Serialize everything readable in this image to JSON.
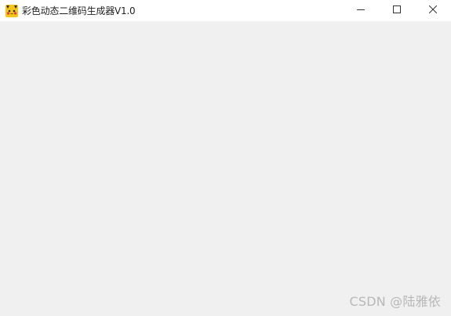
{
  "window": {
    "title": "彩色动态二维码生成器V1.0",
    "app_icon": "pikachu-icon",
    "controls": {
      "minimize": "minimize-icon",
      "maximize": "maximize-icon",
      "close": "close-icon"
    }
  },
  "watermark": {
    "text": "CSDN @陆雅依"
  },
  "colors": {
    "titlebar_bg": "#ffffff",
    "client_bg": "#f0f0f0",
    "icon_yellow": "#f5c518"
  }
}
